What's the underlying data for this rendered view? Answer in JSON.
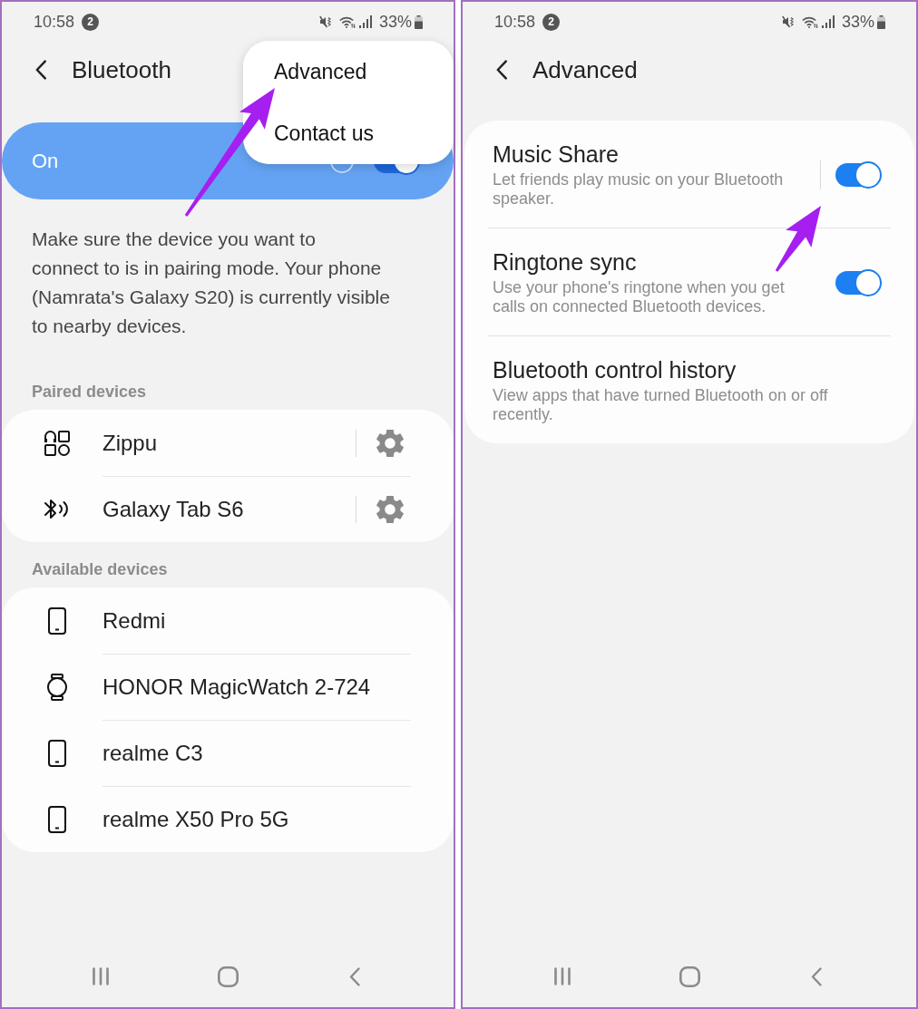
{
  "bluetooth_screen": {
    "status_bar": {
      "time": "10:58",
      "notification_count": "2",
      "battery": "33%"
    },
    "header": {
      "title": "Bluetooth"
    },
    "master_switch": {
      "label": "On",
      "on": true,
      "scanning": true
    },
    "menu": {
      "items": [
        {
          "label": "Advanced"
        },
        {
          "label": "Contact us"
        }
      ]
    },
    "description": "Make sure the device you want to\nconnect to is in pairing mode. Your phone\n(Namrata's Galaxy S20) is currently visible\nto nearby devices.",
    "sections": [
      {
        "title": "Paired devices",
        "kind": "paired",
        "devices": [
          {
            "name": "Zippu",
            "kind": "generic"
          },
          {
            "name": "Galaxy Tab S6",
            "kind": "bluetooth"
          }
        ]
      },
      {
        "title": "Available devices",
        "kind": "available",
        "devices": [
          {
            "name": "Redmi",
            "kind": "phone"
          },
          {
            "name": "HONOR MagicWatch 2-724",
            "kind": "watch"
          },
          {
            "name": "realme C3",
            "kind": "phone"
          },
          {
            "name": "realme X50 Pro 5G",
            "kind": "phone"
          }
        ]
      }
    ],
    "annotation_arrow": true
  },
  "advanced_screen": {
    "status_bar": {
      "time": "10:58",
      "notification_count": "2",
      "battery": "33%"
    },
    "header": {
      "title": "Advanced"
    },
    "settings": [
      {
        "title": "Music Share",
        "subtitle": "Let friends play music on your Bluetooth speaker.",
        "kind": "split_switch",
        "on": true
      },
      {
        "title": "Ringtone sync",
        "subtitle": "Use your phone's ringtone when you get calls on connected Bluetooth devices.",
        "kind": "switch",
        "on": true
      },
      {
        "title": "Bluetooth control history",
        "subtitle": "View apps that have turned Bluetooth on or off recently.",
        "kind": "link"
      }
    ],
    "annotation_arrow": true
  }
}
